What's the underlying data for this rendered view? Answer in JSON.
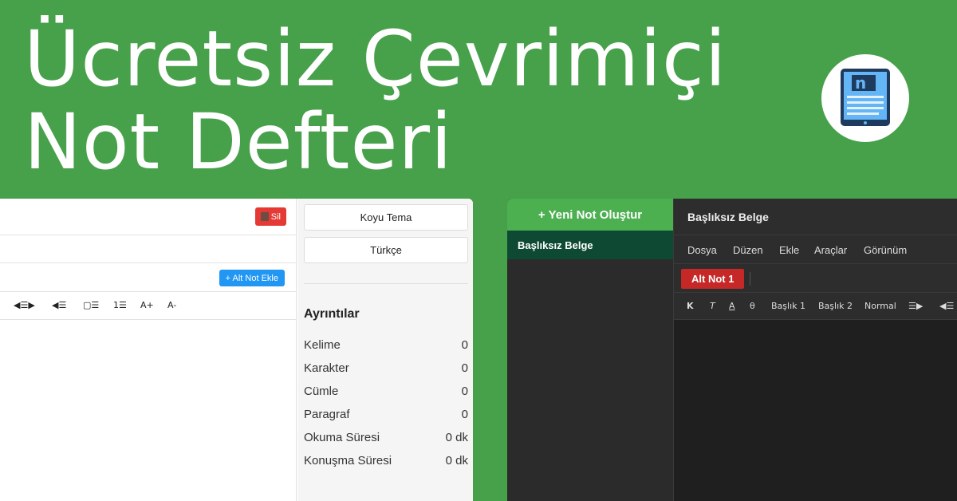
{
  "hero": {
    "line1": "Ücretsiz Çevrimiçi",
    "line2": "Not Defteri",
    "logo_icon": "notepad-tablet-icon"
  },
  "light_app": {
    "delete_label": "Sil",
    "add_subnote_label": "+ Alt Not Ekle",
    "toolbar": [
      "◀☰▶",
      "◀☰",
      "▢☰",
      "1☰",
      "A+",
      "A-"
    ],
    "sidebar": {
      "theme_button": "Koyu Tema",
      "language_button": "Türkçe",
      "details_heading": "Ayrıntılar",
      "stats": [
        {
          "label": "Kelime",
          "value": "0"
        },
        {
          "label": "Karakter",
          "value": "0"
        },
        {
          "label": "Cümle",
          "value": "0"
        },
        {
          "label": "Paragraf",
          "value": "0"
        },
        {
          "label": "Okuma Süresi",
          "value": "0 dk"
        },
        {
          "label": "Konuşma Süresi",
          "value": "0 dk"
        }
      ]
    }
  },
  "dark_app": {
    "new_note_label": "+ Yeni Not Oluştur",
    "note_item_label": "Başlıksız Belge",
    "doc_title": "Başlıksız Belge",
    "menu": [
      "Dosya",
      "Düzen",
      "Ekle",
      "Araçlar",
      "Görünüm"
    ],
    "tab_label": "Alt Not 1",
    "format": [
      "K",
      "T",
      "A",
      "θ",
      "Başlık 1",
      "Başlık 2",
      "Normal",
      "☰▶",
      "◀☰"
    ]
  },
  "colors": {
    "banner_green": "#47a04a",
    "delete_red": "#e53935",
    "add_blue": "#2196f3",
    "new_note_green": "#4caf50",
    "tab_red": "#c62828",
    "note_item_bg": "#0e4a33"
  }
}
